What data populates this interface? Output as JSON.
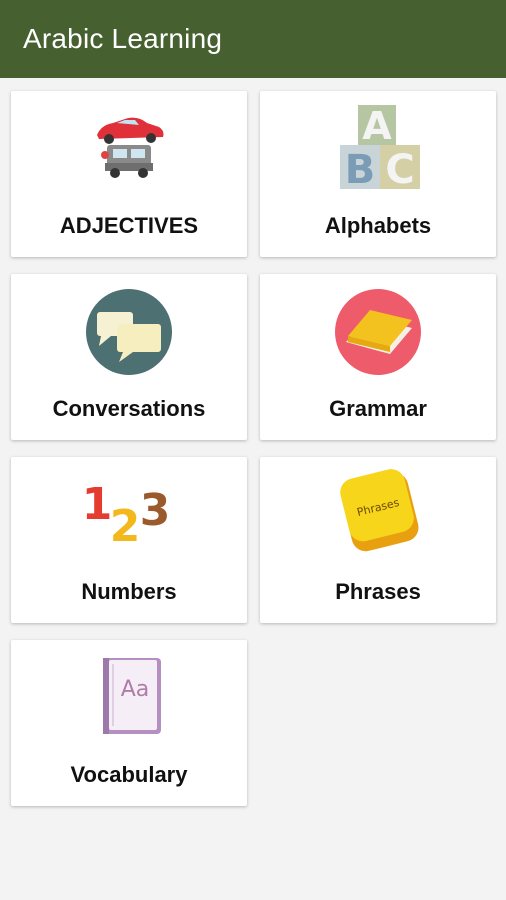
{
  "app": {
    "title": "Arabic Learning"
  },
  "categories": [
    {
      "label": "ADJECTIVES",
      "icon": "cars-icon"
    },
    {
      "label": "Alphabets",
      "icon": "abc-blocks-icon"
    },
    {
      "label": "Conversations",
      "icon": "chat-bubbles-icon"
    },
    {
      "label": "Grammar",
      "icon": "book-icon"
    },
    {
      "label": "Numbers",
      "icon": "numbers-123-icon"
    },
    {
      "label": "Phrases",
      "icon": "phrases-button-icon"
    },
    {
      "label": "Vocabulary",
      "icon": "vocabulary-notebook-icon"
    }
  ],
  "colors": {
    "appbar": "#476030",
    "background": "#f3f3f3",
    "card": "#ffffff"
  }
}
